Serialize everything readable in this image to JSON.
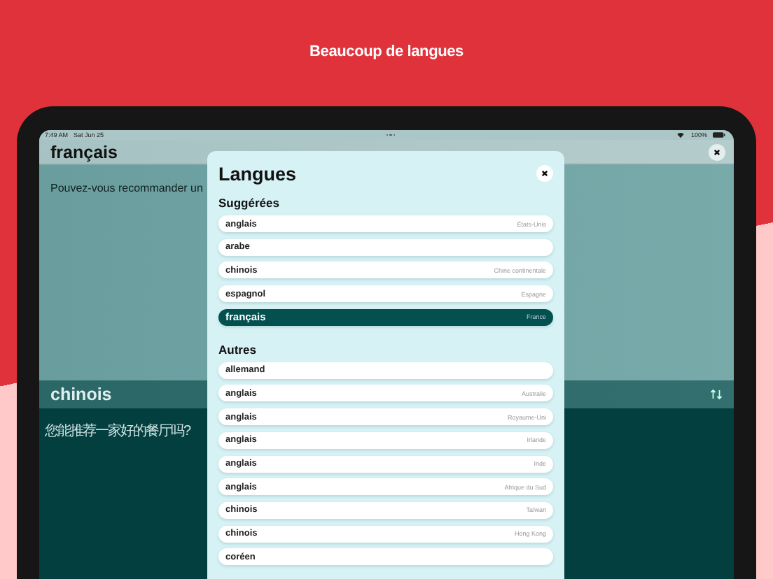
{
  "headline": "Beaucoup de langues",
  "status_bar": {
    "time": "7:49 AM",
    "date": "Sat Jun 25",
    "battery": "100%"
  },
  "source": {
    "language": "français",
    "text": "Pouvez-vous recommander un"
  },
  "target": {
    "language": "chinois",
    "text": "您能推荐一家好的餐厅吗?"
  },
  "modal": {
    "title": "Langues",
    "sections": [
      {
        "title": "Suggérées",
        "items": [
          {
            "name": "anglais",
            "region": "États-Unis",
            "selected": false
          },
          {
            "name": "arabe",
            "selected": false
          },
          {
            "name": "chinois",
            "region": "Chine continentale",
            "selected": false
          },
          {
            "name": "espagnol",
            "region": "Espagne",
            "selected": false
          },
          {
            "name": "français",
            "region": "France",
            "selected": true
          }
        ]
      },
      {
        "title": "Autres",
        "items": [
          {
            "name": "allemand",
            "selected": false
          },
          {
            "name": "anglais",
            "region": "Australie",
            "selected": false
          },
          {
            "name": "anglais",
            "region": "Royaume-Uni",
            "selected": false
          },
          {
            "name": "anglais",
            "region": "Irlande",
            "selected": false
          },
          {
            "name": "anglais",
            "region": "Inde",
            "selected": false
          },
          {
            "name": "anglais",
            "region": "Afrique du Sud",
            "selected": false
          },
          {
            "name": "chinois",
            "region": "Taïwan",
            "selected": false
          },
          {
            "name": "chinois",
            "region": "Hong Kong",
            "selected": false
          },
          {
            "name": "coréen",
            "selected": false
          }
        ]
      }
    ]
  }
}
